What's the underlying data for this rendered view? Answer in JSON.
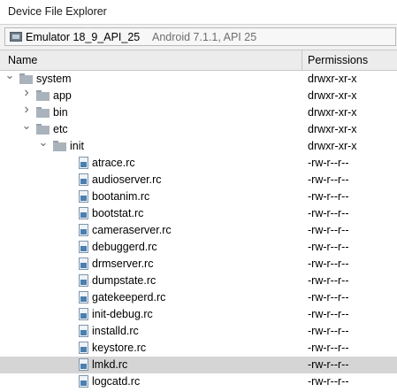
{
  "window": {
    "title": "Device File Explorer"
  },
  "device": {
    "icon": "emulator-device-icon",
    "name": "Emulator 18_9_API_25",
    "info": "Android 7.1.1, API 25"
  },
  "columns": {
    "name": "Name",
    "permissions": "Permissions"
  },
  "tree": [
    {
      "name": "system",
      "perm": "drwxr-xr-x",
      "type": "folder",
      "depth": 0,
      "expanded": true
    },
    {
      "name": "app",
      "perm": "drwxr-xr-x",
      "type": "folder",
      "depth": 1,
      "expanded": false
    },
    {
      "name": "bin",
      "perm": "drwxr-xr-x",
      "type": "folder",
      "depth": 1,
      "expanded": false
    },
    {
      "name": "etc",
      "perm": "drwxr-xr-x",
      "type": "folder",
      "depth": 1,
      "expanded": true
    },
    {
      "name": "init",
      "perm": "drwxr-xr-x",
      "type": "folder",
      "depth": 2,
      "expanded": true
    },
    {
      "name": "atrace.rc",
      "perm": "-rw-r--r--",
      "type": "file",
      "depth": 3
    },
    {
      "name": "audioserver.rc",
      "perm": "-rw-r--r--",
      "type": "file",
      "depth": 3
    },
    {
      "name": "bootanim.rc",
      "perm": "-rw-r--r--",
      "type": "file",
      "depth": 3
    },
    {
      "name": "bootstat.rc",
      "perm": "-rw-r--r--",
      "type": "file",
      "depth": 3
    },
    {
      "name": "cameraserver.rc",
      "perm": "-rw-r--r--",
      "type": "file",
      "depth": 3
    },
    {
      "name": "debuggerd.rc",
      "perm": "-rw-r--r--",
      "type": "file",
      "depth": 3
    },
    {
      "name": "drmserver.rc",
      "perm": "-rw-r--r--",
      "type": "file",
      "depth": 3
    },
    {
      "name": "dumpstate.rc",
      "perm": "-rw-r--r--",
      "type": "file",
      "depth": 3
    },
    {
      "name": "gatekeeperd.rc",
      "perm": "-rw-r--r--",
      "type": "file",
      "depth": 3
    },
    {
      "name": "init-debug.rc",
      "perm": "-rw-r--r--",
      "type": "file",
      "depth": 3
    },
    {
      "name": "installd.rc",
      "perm": "-rw-r--r--",
      "type": "file",
      "depth": 3
    },
    {
      "name": "keystore.rc",
      "perm": "-rw-r--r--",
      "type": "file",
      "depth": 3
    },
    {
      "name": "lmkd.rc",
      "perm": "-rw-r--r--",
      "type": "file",
      "depth": 3,
      "selected": true
    },
    {
      "name": "logcatd.rc",
      "perm": "-rw-r--r--",
      "type": "file",
      "depth": 3
    }
  ]
}
